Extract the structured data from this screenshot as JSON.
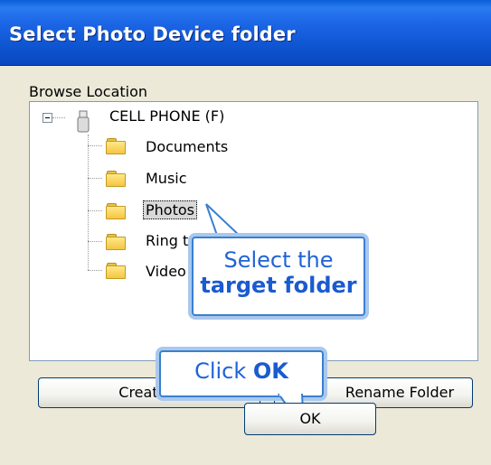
{
  "window": {
    "title": "Select Photo Device folder"
  },
  "browse": {
    "label": "Browse Location"
  },
  "tree": {
    "root": "CELL PHONE (F)",
    "items": [
      "Documents",
      "Music",
      "Photos",
      "Ring t",
      "Video"
    ],
    "selected_index": 2
  },
  "buttons": {
    "create": "Create F",
    "rename": "Rename Folder",
    "ok": "OK"
  },
  "callouts": {
    "select_line1": "Select the",
    "select_line2": "target folder",
    "ok_prefix": "Click ",
    "ok_bold": "OK"
  }
}
